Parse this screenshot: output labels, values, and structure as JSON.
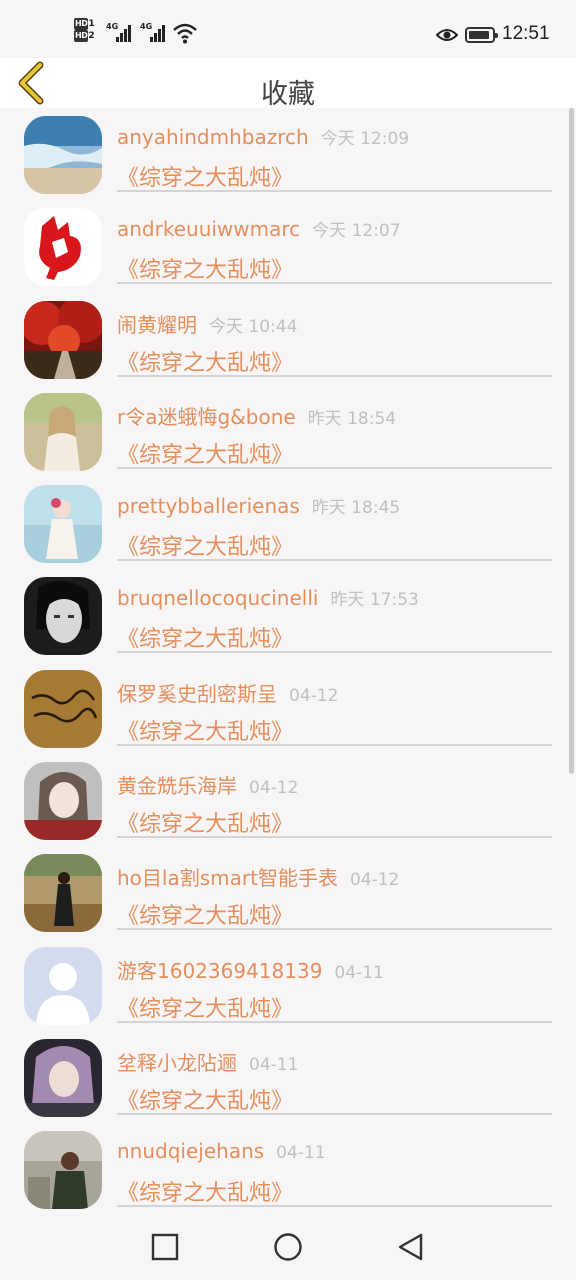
{
  "status_bar": {
    "hd1": "HD",
    "hd1_sub": "1",
    "hd2": "HD",
    "hd2_sub": "2",
    "net1": "4G",
    "net2": "4G",
    "time": "12:51"
  },
  "title_bar": {
    "title": "收藏"
  },
  "items": [
    {
      "name": "anyahindmhbazrch",
      "time": "今天 12:09",
      "book": "《综穿之大乱炖》",
      "avatar": "beach-photo"
    },
    {
      "name": "andrkeuuiwwmarc",
      "time": "今天 12:07",
      "book": "《综穿之大乱炖》",
      "avatar": "red-rooster-papercut"
    },
    {
      "name": "闹黄耀明",
      "time": "今天 10:44",
      "book": "《综穿之大乱炖》",
      "avatar": "red-autumn-trees"
    },
    {
      "name": "r令a迷蛾悔g&bone",
      "time": "昨天 18:54",
      "book": "《综穿之大乱炖》",
      "avatar": "girl-in-field"
    },
    {
      "name": "prettybballerienas",
      "time": "昨天 18:45",
      "book": "《综穿之大乱炖》",
      "avatar": "girl-by-sea"
    },
    {
      "name": "bruqnellocoqucinelli",
      "time": "昨天 17:53",
      "book": "《综穿之大乱炖》",
      "avatar": "bw-portrait"
    },
    {
      "name": "保罗奚史刮密斯呈",
      "time": "04-12",
      "book": "《综穿之大乱炖》",
      "avatar": "handwriting-card"
    },
    {
      "name": "黄金兟乐海岸",
      "time": "04-12",
      "book": "《综穿之大乱炖》",
      "avatar": "girl-portrait"
    },
    {
      "name": "ho目la割smart智能手表",
      "time": "04-12",
      "book": "《综穿之大乱炖》",
      "avatar": "person-in-meadow"
    },
    {
      "name": "游客1602369418139",
      "time": "04-11",
      "book": "《综穿之大乱炖》",
      "avatar": "default-user"
    },
    {
      "name": "坌释小龙阽逦",
      "time": "04-11",
      "book": "《综穿之大乱炖》",
      "avatar": "girl-purple-hair"
    },
    {
      "name": "nnudqiejehans",
      "time": "04-11",
      "book": "《综穿之大乱炖》",
      "avatar": "man-outdoors"
    }
  ],
  "colors": {
    "accent": "#e48f5c",
    "timestamp": "#c0c0c0",
    "divider": "#d5d3d4",
    "back_arrow": "#e8c43a"
  }
}
